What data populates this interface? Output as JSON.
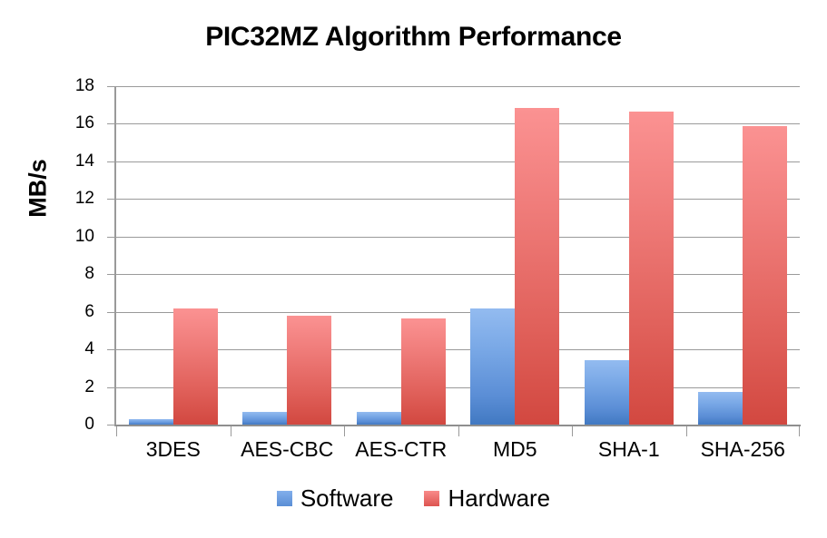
{
  "chart_data": {
    "type": "bar",
    "title": "PIC32MZ Algorithm Performance",
    "xlabel": "",
    "ylabel": "MB/s",
    "categories": [
      "3DES",
      "AES-CBC",
      "AES-CTR",
      "MD5",
      "SHA-1",
      "SHA-256"
    ],
    "series": [
      {
        "name": "Software",
        "color": "#5b8ed6",
        "values": [
          0.3,
          0.7,
          0.7,
          6.2,
          3.45,
          1.75
        ]
      },
      {
        "name": "Hardware",
        "color": "#dd5450",
        "values": [
          6.2,
          5.8,
          5.65,
          16.85,
          16.65,
          15.9
        ]
      }
    ],
    "ylim": [
      0,
      18
    ],
    "y_ticks": [
      0,
      2,
      4,
      6,
      8,
      10,
      12,
      14,
      16,
      18
    ],
    "y_tick_labels": [
      "0",
      "2",
      "4",
      "6",
      "8",
      "10",
      "12",
      "14",
      "16",
      "18"
    ],
    "grid": true,
    "legend_position": "bottom",
    "legend_entries": [
      "Software",
      "Hardware"
    ]
  }
}
